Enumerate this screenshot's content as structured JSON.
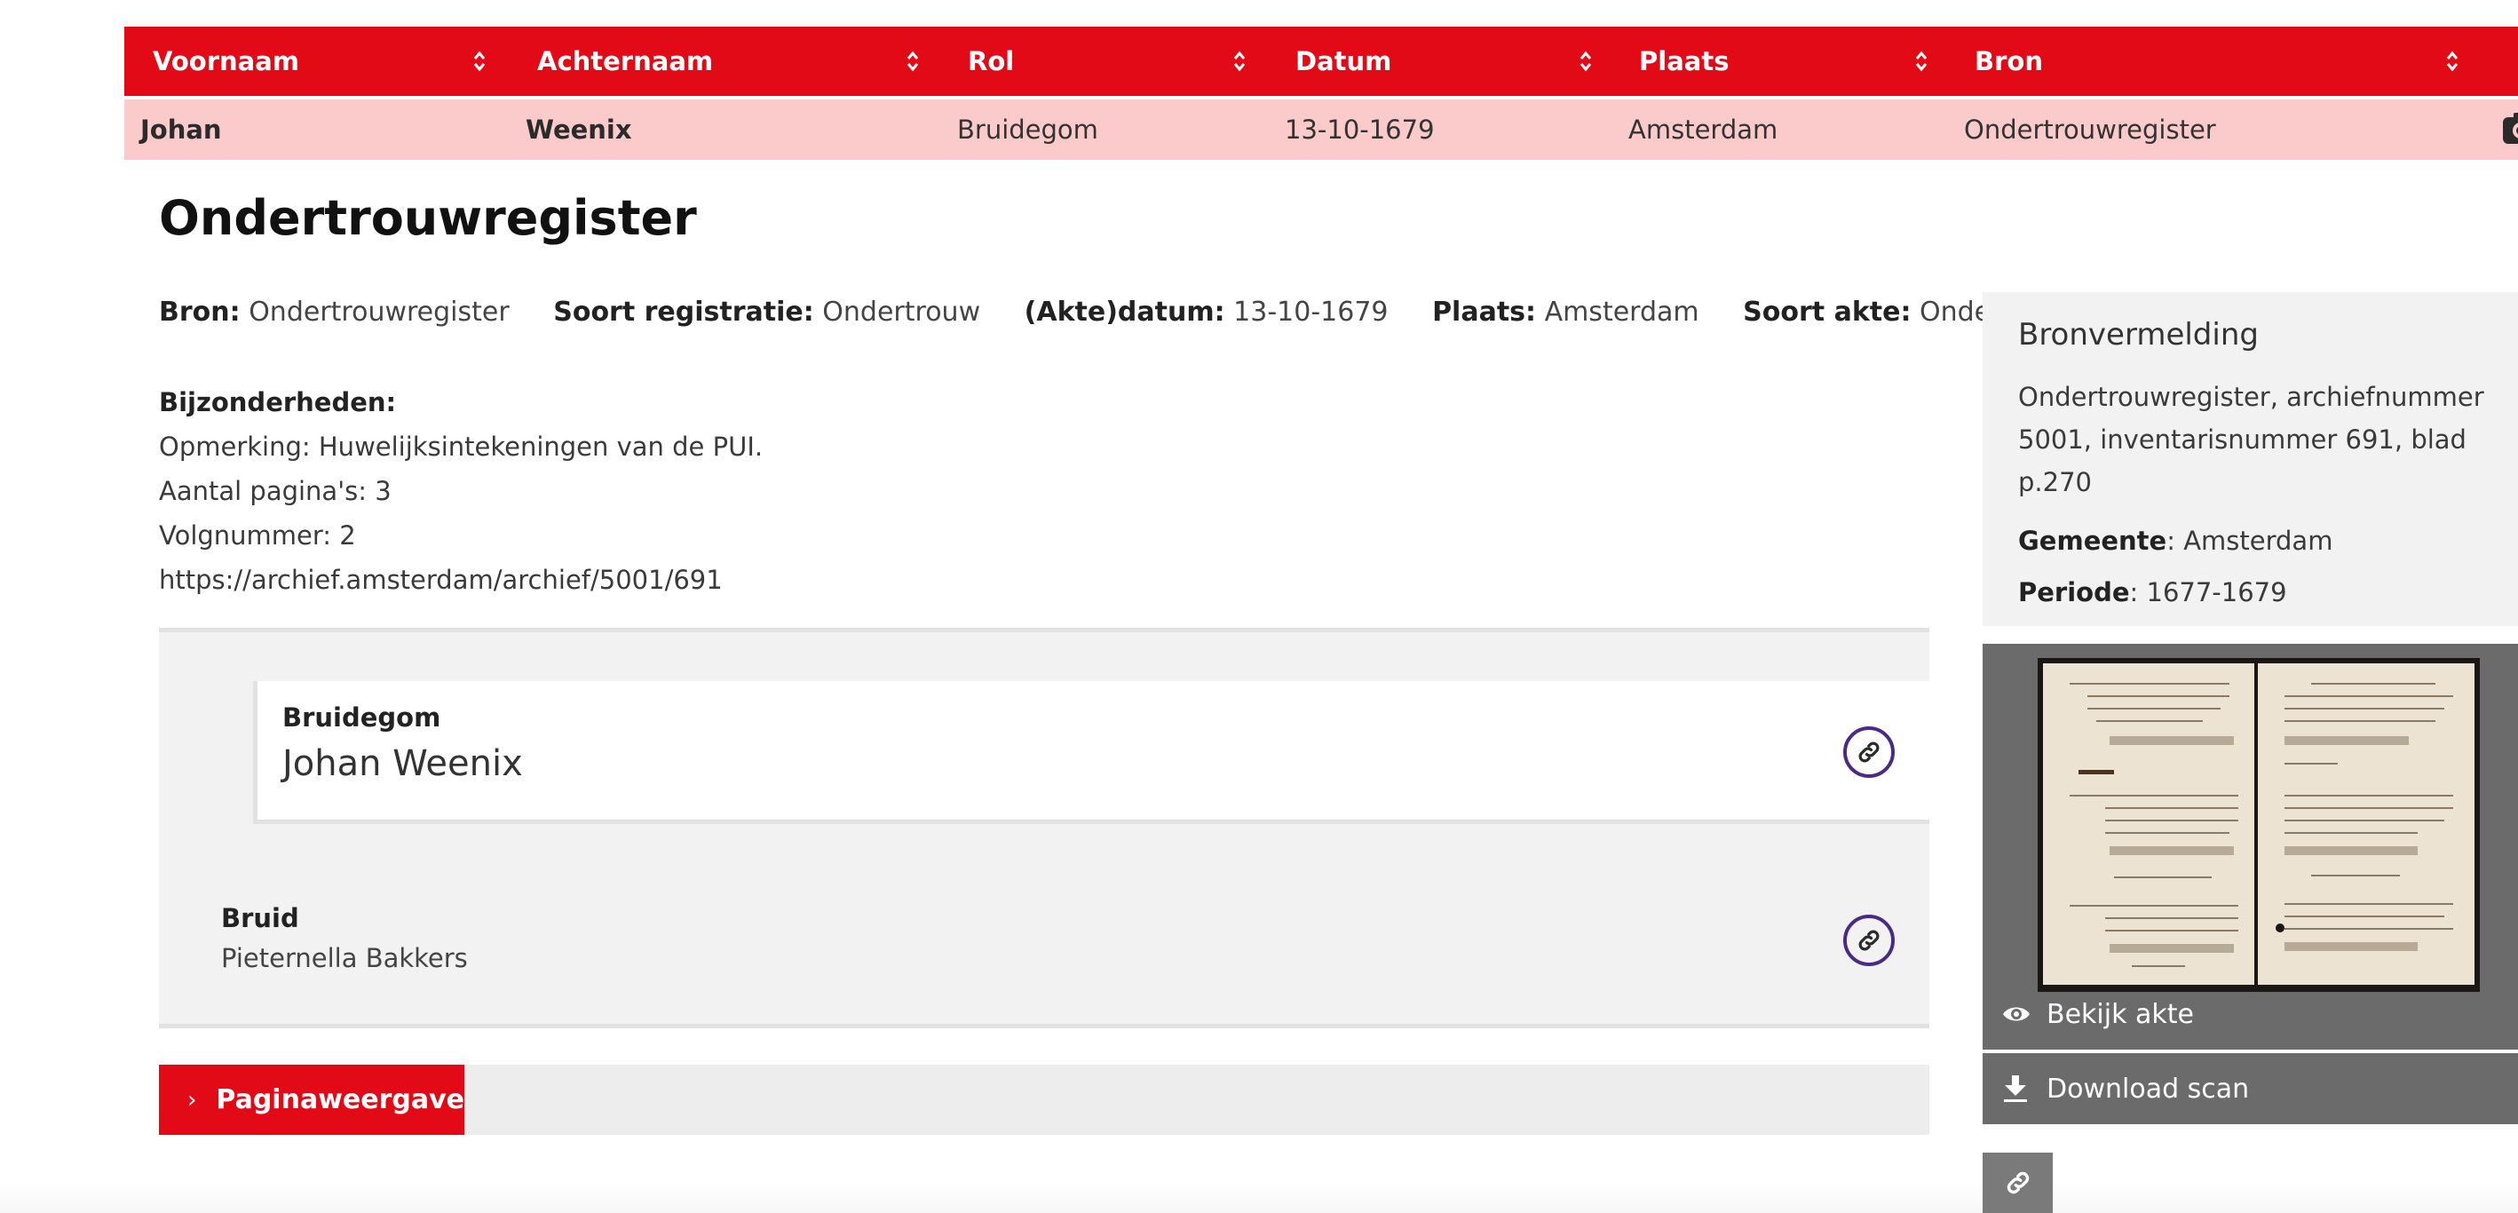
{
  "results_table": {
    "columns": [
      {
        "label": "Voornaam"
      },
      {
        "label": "Achternaam"
      },
      {
        "label": "Rol"
      },
      {
        "label": "Datum"
      },
      {
        "label": "Plaats"
      },
      {
        "label": "Bron"
      }
    ],
    "rows": [
      {
        "voornaam": "Johan",
        "achternaam": "Weenix",
        "rol": "Bruidegom",
        "datum": "13-10-1679",
        "plaats": "Amsterdam",
        "bron": "Ondertrouwregister",
        "action_icon": "camera-icon"
      }
    ],
    "colors": {
      "header_bg": "#e30a18",
      "selected_row_bg": "#fbcacb"
    }
  },
  "record": {
    "title": "Ondertrouwregister",
    "meta": [
      {
        "label": "Bron:",
        "value": "Ondertrouwregister"
      },
      {
        "label": "Soort registratie:",
        "value": "Ondertrouw"
      },
      {
        "label": "(Akte)datum:",
        "value": "13-10-1679"
      },
      {
        "label": "Plaats:",
        "value": "Amsterdam"
      },
      {
        "label": "Soort akte:",
        "value": "Ondertrouw"
      }
    ],
    "details": {
      "heading": "Bijzonderheden:",
      "lines": [
        "Opmerking: Huwelijksintekeningen van de PUI.",
        "Aantal pagina's: 3",
        "Volgnummer: 2",
        "https://archief.amsterdam/archief/5001/691"
      ]
    },
    "persons": [
      {
        "role": "Bruidegom",
        "name": "Johan Weenix",
        "link_icon": "link-icon",
        "highlighted": true
      },
      {
        "role": "Bruid",
        "name": "Pieternella Bakkers",
        "link_icon": "link-icon",
        "highlighted": false
      }
    ],
    "page_view_button": "Paginaweergave"
  },
  "sidebar": {
    "citation": {
      "title": "Bronvermelding",
      "text": "Ondertrouwregister, archiefnummer 5001, inventarisnummer 691, blad p.270",
      "gemeente_label": "Gemeente",
      "gemeente_value": ": Amsterdam",
      "periode_label": "Periode",
      "periode_value": ": 1677-1679"
    },
    "scan": {
      "view_label": "Bekijk akte",
      "view_icon": "eye-icon",
      "download_label": "Download scan",
      "download_icon": "download-icon",
      "share_icon": "link-icon"
    },
    "colors": {
      "scan_bg": "#6b6b6b",
      "link_circle": "#4b2a86"
    }
  }
}
